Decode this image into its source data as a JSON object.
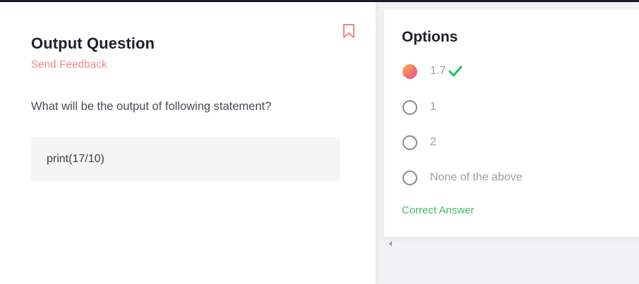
{
  "question": {
    "title": "Output Question",
    "send_feedback_label": "Send Feedback",
    "text": "What will be the output of following statement?",
    "code": "print(17/10)"
  },
  "options_panel": {
    "title": "Options",
    "items": [
      {
        "label": "1.7",
        "selected": true,
        "correct": true
      },
      {
        "label": "1",
        "selected": false,
        "correct": false
      },
      {
        "label": "2",
        "selected": false,
        "correct": false
      },
      {
        "label": "None of the above",
        "selected": false,
        "correct": false
      }
    ],
    "correct_answer_label": "Correct Answer"
  },
  "icons": {
    "bookmark": "bookmark-icon",
    "check": "checkmark-icon",
    "scroll": "scroll-left-arrow-icon"
  },
  "colors": {
    "accent_feedback": "#f08585",
    "correct_green": "#3fbf62",
    "check_green": "#22c05c",
    "bookmark": "#f08585",
    "topbar": "#1d1b30"
  }
}
